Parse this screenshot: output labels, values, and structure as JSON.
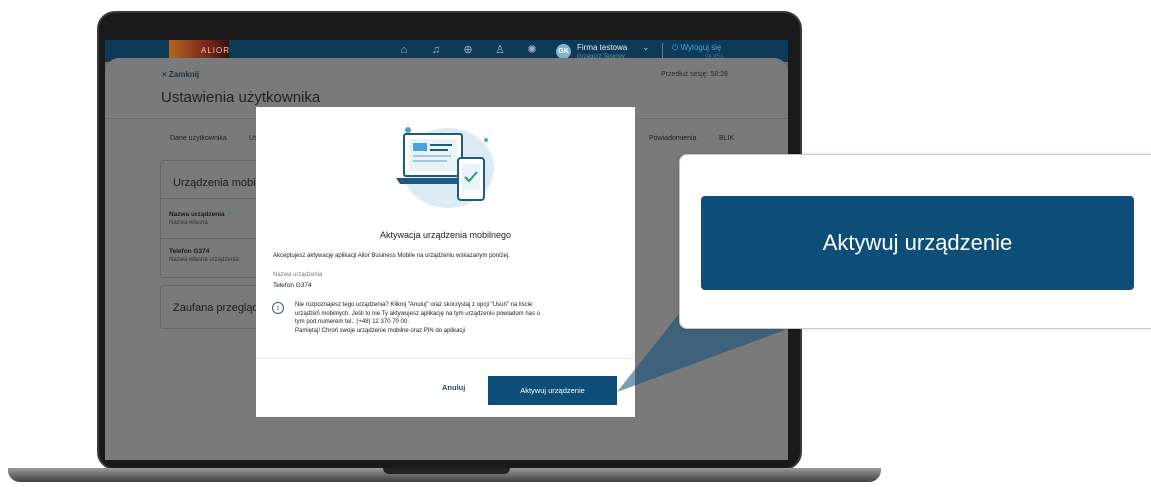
{
  "topbar": {
    "logo_text": "ALIOR",
    "avatar_initials": "GK",
    "company": "Firma testowa",
    "user": "Grzegorz Testowy",
    "logout": "Wyloguj się",
    "logout_timer": "04:45s"
  },
  "settings": {
    "close": "× Zamknij",
    "session": "Przedłuż sesję: 58:28",
    "title": "Ustawienia użytkownika",
    "tabs": [
      "Dane użytkownika",
      "Us",
      "Powiadomienia",
      "BLIK"
    ],
    "devices_title": "Urządzenia mobil",
    "device_name_col": "Nazwa urządzenia",
    "device_name_sub": "Nazwa własna",
    "device_row_name": "Telefon G374",
    "device_row_sub": "Nazwa własna urządzenia",
    "trusted_title": "Zaufana przegląd"
  },
  "modal": {
    "title": "Aktywacja urządzenia mobilnego",
    "description": "Akceptujesz aktywację aplikacji Alior Business Mobile na urządzeniu wskazanym poniżej.",
    "field_label": "Nazwa urządzenia",
    "field_value": "Telefon G374",
    "info_line1": "Nie rozpoznajesz tego urządzenia? Kliknij \"Anuluj\" oraz skorzystaj z opcji \"Usuń\" na liście",
    "info_line2": "urządzeń mobilnych. Jeśli to nie Ty aktywujesz aplikację na tym urządzeniu powiadom nas o",
    "info_line3": "tym pod numerem tel.: (+48) 12 370 70 00.",
    "info_line4": "Pamiętaj! Chroń swoje urządzenie mobilne oraz PIN do aplikacji",
    "cancel": "Anuluj",
    "activate": "Aktywuj urządzenie"
  },
  "callout": {
    "button_label": "Aktywuj urządzenie"
  },
  "colors": {
    "primary": "#0d4e78",
    "topbar": "#0d3a57",
    "link": "#4aa3d8"
  }
}
